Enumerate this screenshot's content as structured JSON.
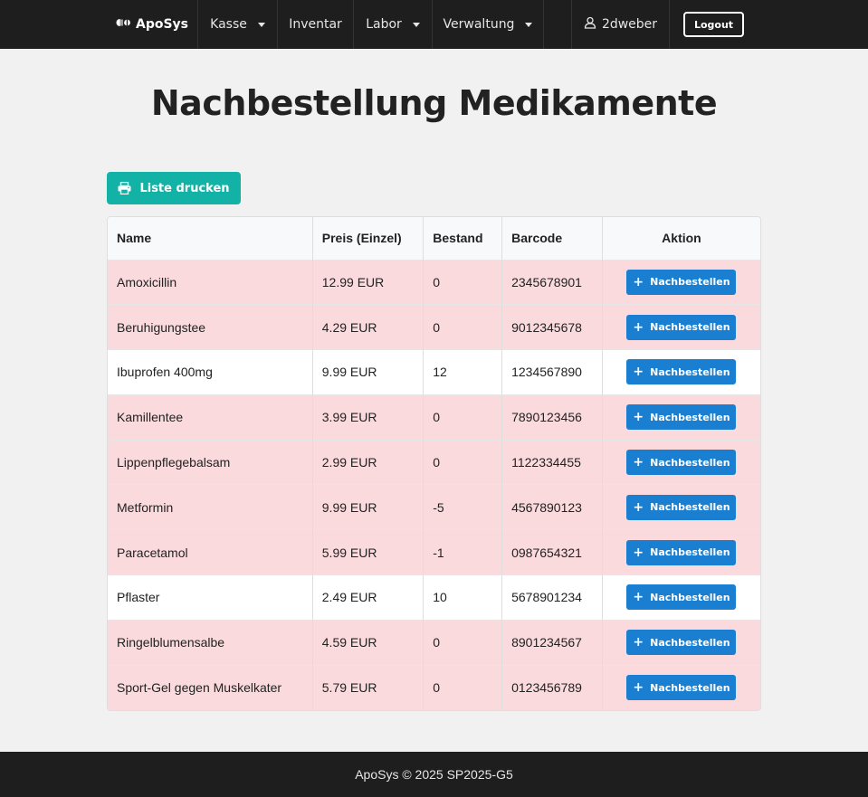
{
  "nav": {
    "brand": "ApoSys",
    "items": [
      {
        "label": "Kasse",
        "dropdown": true
      },
      {
        "label": "Inventar",
        "dropdown": false
      },
      {
        "label": "Labor",
        "dropdown": true
      },
      {
        "label": "Verwaltung",
        "dropdown": true
      }
    ],
    "user": "2dweber",
    "logout": "Logout"
  },
  "page": {
    "title": "Nachbestellung Medikamente",
    "print_label": "Liste drucken"
  },
  "table": {
    "headers": [
      "Name",
      "Preis (Einzel)",
      "Bestand",
      "Barcode",
      "Aktion"
    ],
    "action_label": "Nachbestellen",
    "rows": [
      {
        "name": "Amoxicillin",
        "price": "12.99 EUR",
        "stock": "0",
        "barcode": "2345678901",
        "low": true
      },
      {
        "name": "Beruhigungstee",
        "price": "4.29 EUR",
        "stock": "0",
        "barcode": "9012345678",
        "low": true
      },
      {
        "name": "Ibuprofen 400mg",
        "price": "9.99 EUR",
        "stock": "12",
        "barcode": "1234567890",
        "low": false
      },
      {
        "name": "Kamillentee",
        "price": "3.99 EUR",
        "stock": "0",
        "barcode": "7890123456",
        "low": true
      },
      {
        "name": "Lippenpflegebalsam",
        "price": "2.99 EUR",
        "stock": "0",
        "barcode": "1122334455",
        "low": true
      },
      {
        "name": "Metformin",
        "price": "9.99 EUR",
        "stock": "-5",
        "barcode": "4567890123",
        "low": true
      },
      {
        "name": "Paracetamol",
        "price": "5.99 EUR",
        "stock": "-1",
        "barcode": "0987654321",
        "low": true
      },
      {
        "name": "Pflaster",
        "price": "2.49 EUR",
        "stock": "10",
        "barcode": "5678901234",
        "low": false
      },
      {
        "name": "Ringelblumensalbe",
        "price": "4.59 EUR",
        "stock": "0",
        "barcode": "8901234567",
        "low": true
      },
      {
        "name": "Sport-Gel gegen Muskelkater",
        "price": "5.79 EUR",
        "stock": "0",
        "barcode": "0123456789",
        "low": true
      }
    ]
  },
  "footer": {
    "text": "ApoSys © 2025 SP2025-G5"
  },
  "colors": {
    "navbar": "#1e1e1e",
    "print_button": "#12b3a6",
    "order_button": "#1a7fd0",
    "low_stock_row": "#fadadd"
  },
  "icons": {
    "brand": "pills-icon",
    "user": "user-icon",
    "print": "print-icon",
    "order": "plus-icon"
  }
}
